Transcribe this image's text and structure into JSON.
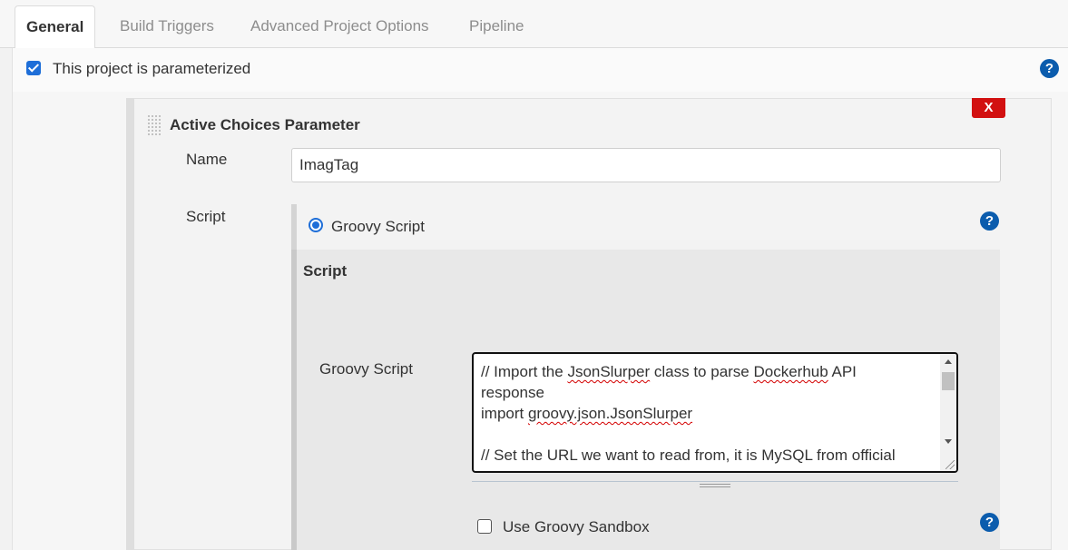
{
  "tabs": [
    {
      "label": "General",
      "active": true
    },
    {
      "label": "Build Triggers",
      "active": false
    },
    {
      "label": "Advanced Project Options",
      "active": false
    },
    {
      "label": "Pipeline",
      "active": false
    }
  ],
  "parameterized": {
    "label": "This project is parameterized",
    "checked": true
  },
  "param_block": {
    "title": "Active Choices Parameter",
    "delete_label": "X",
    "name_label": "Name",
    "name_value": "ImagTag",
    "script_label": "Script",
    "script_type": {
      "label": "Groovy Script",
      "selected": true
    },
    "script_section_title": "Script",
    "groovy_script_label": "Groovy Script",
    "code_lines": [
      "// Import the JsonSlurper class to parse Dockerhub API",
      "response",
      "import groovy.json.JsonSlurper",
      "",
      "// Set the URL we want to read from, it is MySQL from official"
    ],
    "sandbox": {
      "label": "Use Groovy Sandbox",
      "checked": false
    }
  },
  "help_icon": "?",
  "colors": {
    "accent": "#1e6ed8",
    "help": "#0b5cad",
    "delete": "#d21010"
  }
}
